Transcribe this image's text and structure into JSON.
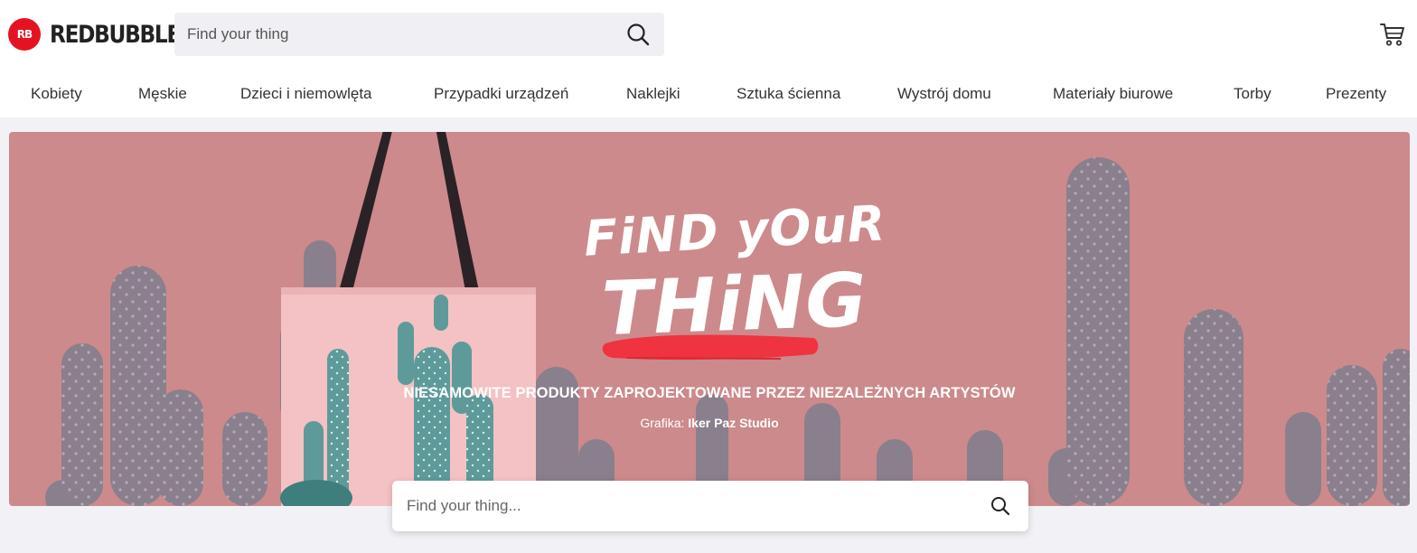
{
  "brand": {
    "logo_mark": "RB",
    "name": "REDBUBBLE",
    "color": "#e41321"
  },
  "header": {
    "search_placeholder": "Find your thing",
    "search_icon": "search-icon",
    "cart_icon": "cart-icon"
  },
  "nav": {
    "items": [
      {
        "label": "Kobiety"
      },
      {
        "label": "Męskie"
      },
      {
        "label": "Dzieci i niemowlęta"
      },
      {
        "label": "Przypadki urządzeń"
      },
      {
        "label": "Naklejki"
      },
      {
        "label": "Sztuka ścienna"
      },
      {
        "label": "Wystrój domu"
      },
      {
        "label": "Materiały biurowe"
      },
      {
        "label": "Torby"
      },
      {
        "label": "Prezenty"
      }
    ]
  },
  "hero": {
    "title_line1": "FiND yOuR",
    "title_line2": "THiNG",
    "subtitle": "NIESAMOWITE PRODUKTY ZAPROJEKTOWANE PRZEZ NIEZALEŻNYCH ARTYSTÓW",
    "credit_label": "Grafika:",
    "credit_artist": "Iker Paz Studio",
    "search_placeholder": "Find your thing...",
    "background_color": "#cc8a8c",
    "accent_color": "#ef3340"
  }
}
